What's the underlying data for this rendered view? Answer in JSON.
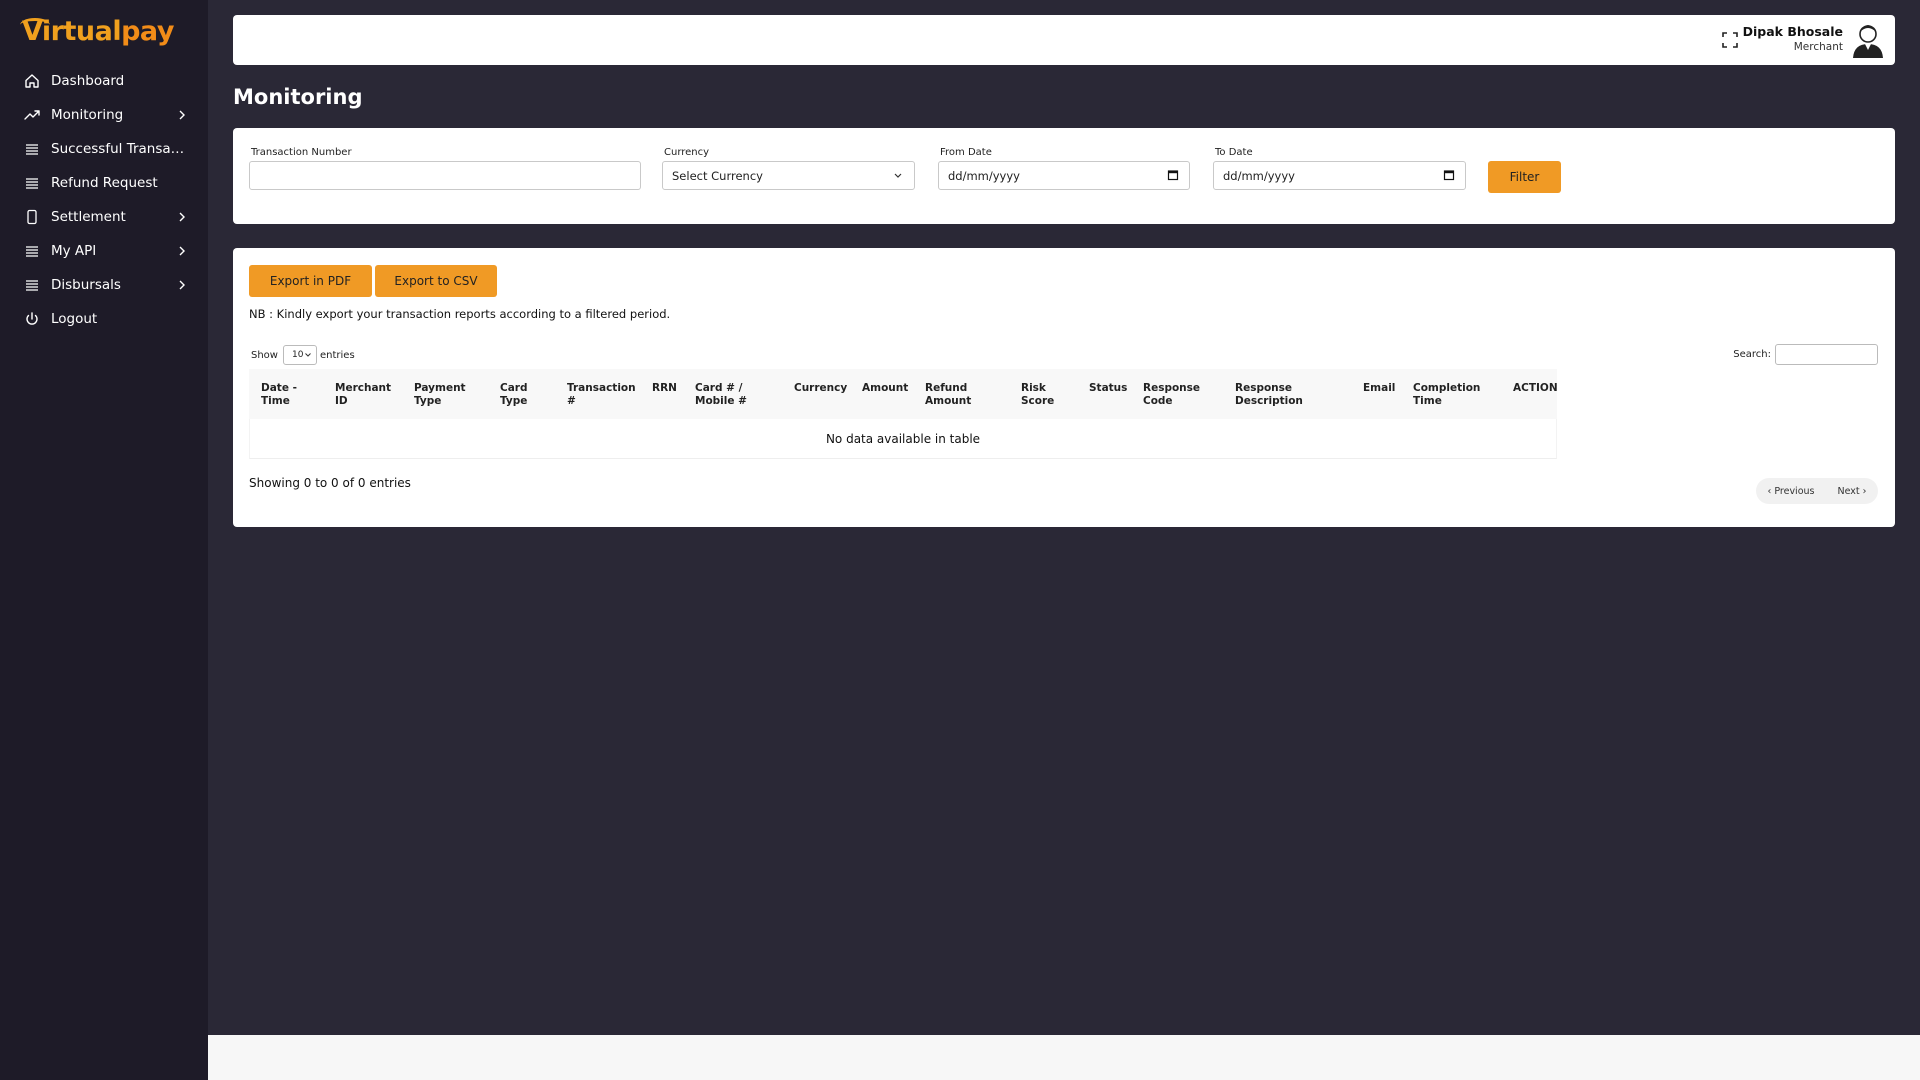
{
  "brand": {
    "logo_v": "V",
    "logo_rtual": "irtual",
    "logo_pay": "pay",
    "accent": "#f0a01e"
  },
  "sidebar": {
    "items": [
      {
        "label": "Dashboard",
        "icon": "home-icon",
        "has_submenu": false
      },
      {
        "label": "Monitoring",
        "icon": "trend-icon",
        "has_submenu": true
      },
      {
        "label": "Successful Transactions",
        "icon": "list-icon",
        "has_submenu": false
      },
      {
        "label": "Refund Request",
        "icon": "list-icon",
        "has_submenu": false
      },
      {
        "label": "Settlement",
        "icon": "tablet-icon",
        "has_submenu": true
      },
      {
        "label": "My API",
        "icon": "list-icon",
        "has_submenu": true
      },
      {
        "label": "Disbursals",
        "icon": "list-icon",
        "has_submenu": true
      },
      {
        "label": "Logout",
        "icon": "power-icon",
        "has_submenu": false
      }
    ]
  },
  "header": {
    "user_name": "Dipak Bhosale",
    "user_role": "Merchant"
  },
  "page": {
    "title": "Monitoring"
  },
  "filters": {
    "transaction_number": {
      "label": "Transaction Number",
      "value": ""
    },
    "currency": {
      "label": "Currency",
      "value": "Select Currency"
    },
    "from_date": {
      "label": "From Date",
      "value": "dd/mm/yyyy"
    },
    "to_date": {
      "label": "To Date",
      "value": "dd/mm/yyyy"
    },
    "filter_button": "Filter"
  },
  "export": {
    "pdf_label": "Export in PDF",
    "csv_label": "Export to CSV",
    "note": "NB : Kindly export your transaction reports according to a filtered period."
  },
  "table": {
    "show_label": "Show",
    "entries_value": "10",
    "entries_label": "entries",
    "search_label": "Search:",
    "columns": [
      [
        "Date -",
        "Time"
      ],
      [
        "Merchant",
        "ID"
      ],
      [
        "Payment",
        "Type"
      ],
      [
        "Card",
        "Type"
      ],
      [
        "Transaction",
        "#"
      ],
      [
        "RRN",
        ""
      ],
      [
        "Card # /",
        "Mobile #"
      ],
      [
        "Currency",
        ""
      ],
      [
        "Amount",
        ""
      ],
      [
        "Refund",
        "Amount"
      ],
      [
        "Risk",
        "Score"
      ],
      [
        "Status",
        ""
      ],
      [
        "Response",
        "Code"
      ],
      [
        "Response",
        "Description"
      ],
      [
        "Email",
        ""
      ],
      [
        "Completion",
        "Time"
      ],
      [
        "ACTION",
        ""
      ]
    ],
    "empty_text": "No data available in table",
    "showing_text": "Showing 0 to 0 of 0 entries",
    "prev_label": "‹ Previous",
    "next_label": "Next ›"
  }
}
